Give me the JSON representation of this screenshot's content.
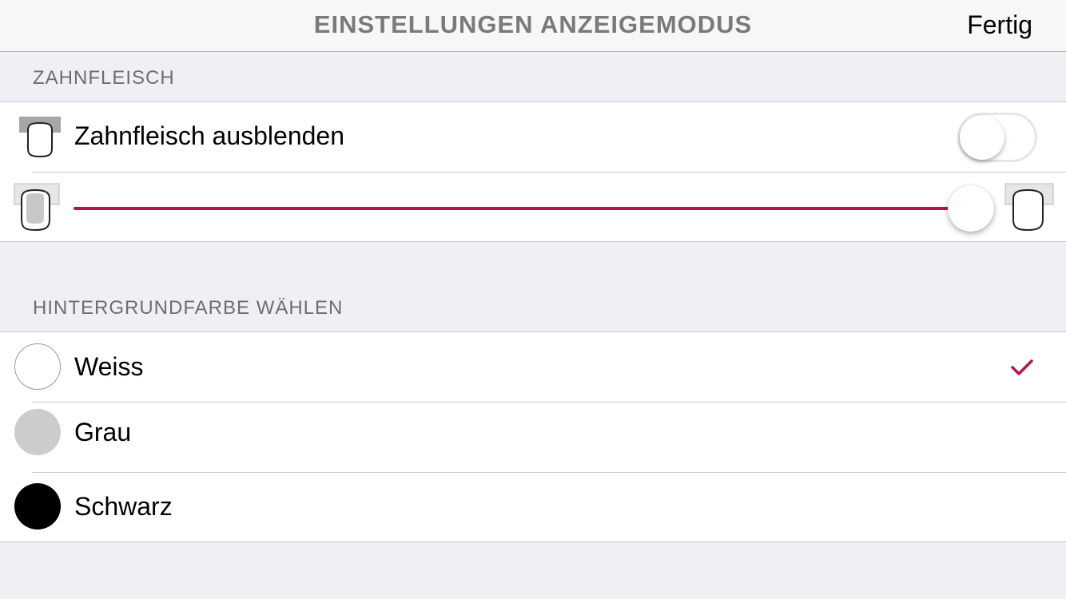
{
  "navbar": {
    "title": "EINSTELLUNGEN ANZEIGEMODUS",
    "done_label": "Fertig"
  },
  "gum_section": {
    "header": "ZAHNFLEISCH",
    "hide_gums_label": "Zahnfleisch ausblenden",
    "hide_gums_on": false,
    "opacity_slider_value": 1.0,
    "accent_color": "#b5134f"
  },
  "background_section": {
    "header": "HINTERGRUNDFARBE WÄHLEN",
    "options": [
      {
        "label": "Weiss",
        "color": "#ffffff",
        "selected": true
      },
      {
        "label": "Grau",
        "color": "#cccccc",
        "selected": false
      },
      {
        "label": "Schwarz",
        "color": "#000000",
        "selected": false
      }
    ]
  }
}
